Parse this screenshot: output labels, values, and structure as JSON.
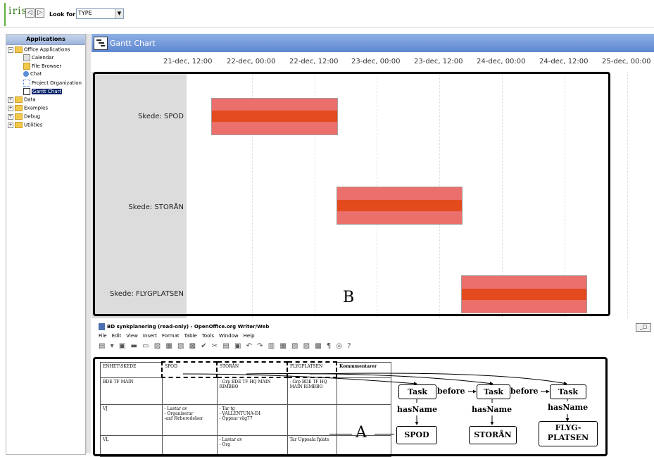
{
  "app": {
    "logo": "iris",
    "nav_back": "◁",
    "nav_forward": "▷",
    "look_for_label": "Look for:",
    "look_for_value": "TYPE"
  },
  "sidebar": {
    "title": "Applications",
    "items": [
      {
        "label": "Office Applications",
        "expanded": true
      },
      {
        "label": "Calendar"
      },
      {
        "label": "File Browser"
      },
      {
        "label": "Chat"
      },
      {
        "label": "Project Organization"
      },
      {
        "label": "Gantt Chart",
        "selected": true
      },
      {
        "label": "Data"
      },
      {
        "label": "Examples"
      },
      {
        "label": "Debug"
      },
      {
        "label": "Utilities"
      }
    ]
  },
  "gantt": {
    "title": "Gantt Chart",
    "ticks": [
      "21-dec, 12:00",
      "22-dec, 00:00",
      "22-dec, 12:00",
      "23-dec, 00:00",
      "23-dec, 12:00",
      "24-dec, 00:00",
      "24-dec, 12:00",
      "25-dec, 00:00"
    ],
    "rows": [
      {
        "label": "Skede: SPOD",
        "start": "21-dec, 14:00",
        "end": "22-dec, 14:00"
      },
      {
        "label": "Skede: STORÅN",
        "start": "22-dec, 14:00",
        "end": "23-dec, 14:00"
      },
      {
        "label": "Skede: FLYGPLATSEN",
        "start": "23-dec, 14:00",
        "end": "24-dec, 14:00"
      }
    ],
    "annotation": "B"
  },
  "writer": {
    "title": "BD synkplanering (read-only) - OpenOffice.org Writer/Web",
    "menu": [
      "File",
      "Edit",
      "View",
      "Insert",
      "Format",
      "Table",
      "Tools",
      "Window",
      "Help"
    ],
    "table": {
      "headers": [
        "ENHET\\SKEDE",
        "SPOD",
        "STORÅN",
        "FLYGPLATSEN",
        "Kommmentarer"
      ],
      "rows": [
        [
          "BDE TF MAIN",
          "",
          "- Grp BDE TF HQ MAIN RIMBBO",
          "- Grp BDE TF HQ MAIN RIMBBO",
          ""
        ],
        [
          "VJ",
          "- Lastar av\n- Organiserar\n-anf förberedelser",
          "- Tar tg\n- VALLENTUNA-E4\n- Öppnar väg77",
          "",
          ""
        ],
        [
          "VL",
          "",
          "- Lastar av\n- Org",
          "Tar Uppsala fplats",
          ""
        ]
      ]
    },
    "annotation": "A"
  },
  "ontology": {
    "task_label": "Task",
    "before_label": "before",
    "hasname_label": "hasName",
    "names": [
      "SPOD",
      "STORÅN",
      "FLYG-\nPLATSEN"
    ]
  }
}
